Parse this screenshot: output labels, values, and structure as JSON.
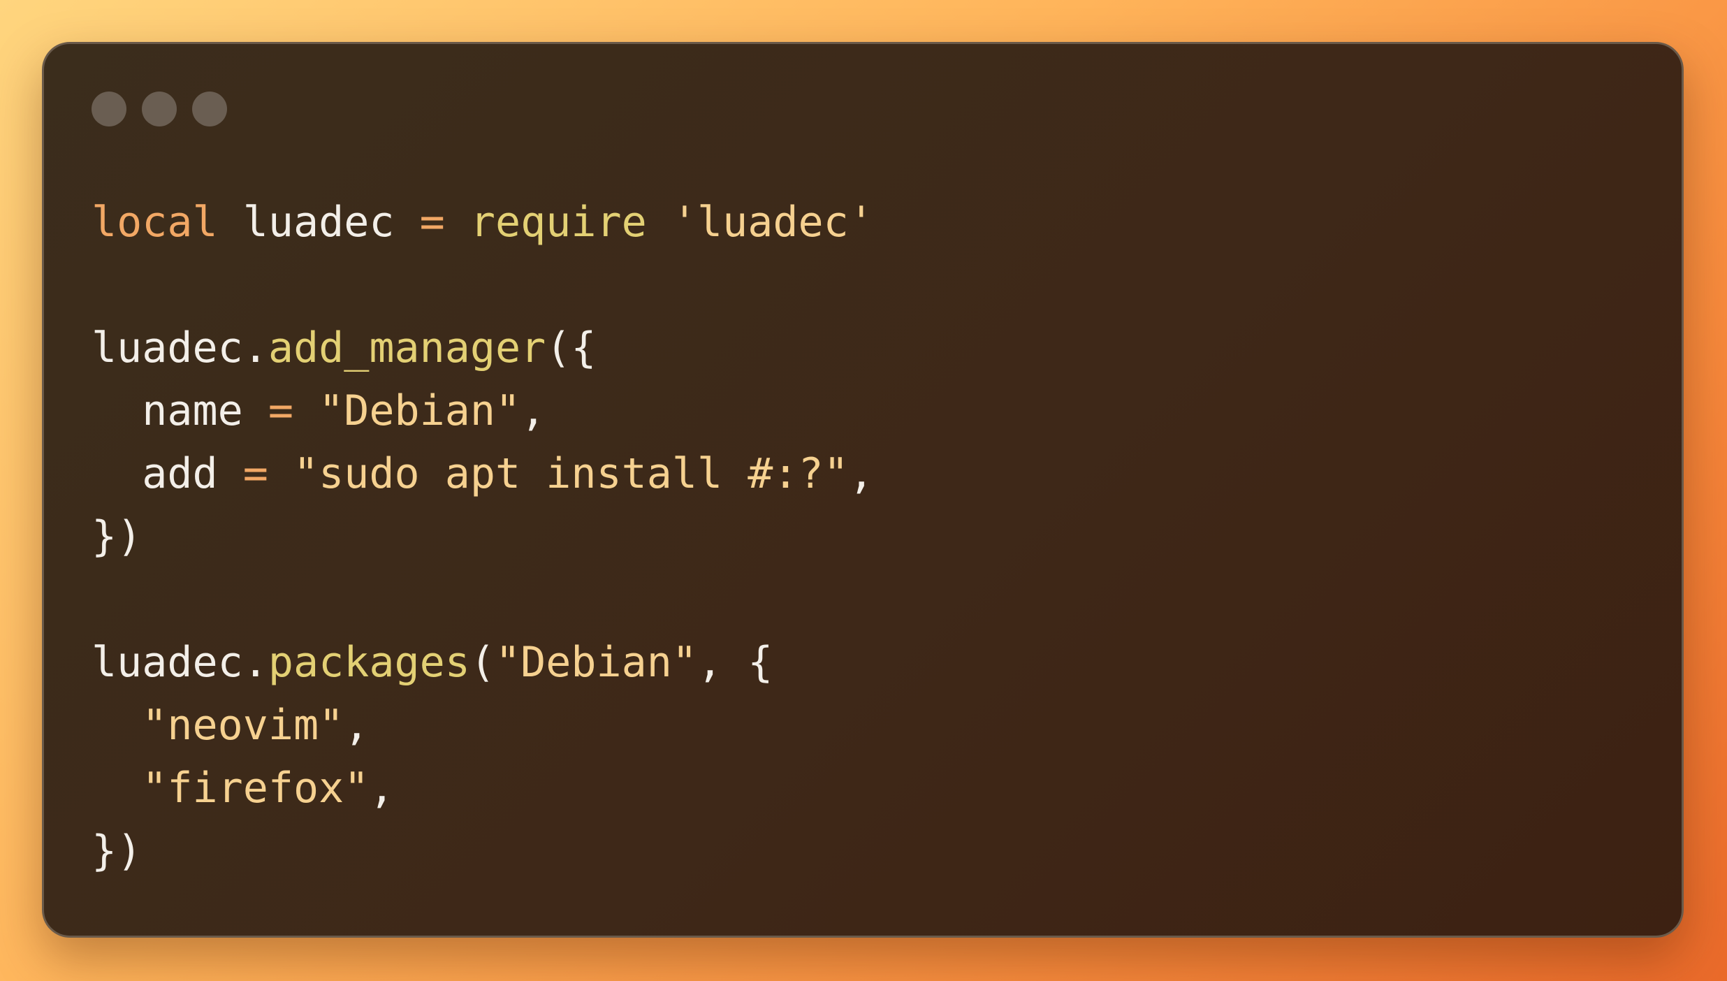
{
  "window": {
    "controls": [
      "window-dot-1",
      "window-dot-2",
      "window-dot-3"
    ]
  },
  "code": {
    "language": "lua",
    "lines": [
      [
        {
          "text": "local",
          "type": "keyword"
        },
        {
          "text": " ",
          "type": "punct"
        },
        {
          "text": "luadec",
          "type": "ident"
        },
        {
          "text": " ",
          "type": "punct"
        },
        {
          "text": "=",
          "type": "op"
        },
        {
          "text": " ",
          "type": "punct"
        },
        {
          "text": "require",
          "type": "func"
        },
        {
          "text": " ",
          "type": "punct"
        },
        {
          "text": "'luadec'",
          "type": "string"
        }
      ],
      [],
      [
        {
          "text": "luadec",
          "type": "ident"
        },
        {
          "text": ".",
          "type": "punct"
        },
        {
          "text": "add_manager",
          "type": "func"
        },
        {
          "text": "({",
          "type": "punct"
        }
      ],
      [
        {
          "text": "  ",
          "type": "punct"
        },
        {
          "text": "name",
          "type": "ident"
        },
        {
          "text": " ",
          "type": "punct"
        },
        {
          "text": "=",
          "type": "op"
        },
        {
          "text": " ",
          "type": "punct"
        },
        {
          "text": "\"Debian\"",
          "type": "string"
        },
        {
          "text": ",",
          "type": "punct"
        }
      ],
      [
        {
          "text": "  ",
          "type": "punct"
        },
        {
          "text": "add",
          "type": "ident"
        },
        {
          "text": " ",
          "type": "punct"
        },
        {
          "text": "=",
          "type": "op"
        },
        {
          "text": " ",
          "type": "punct"
        },
        {
          "text": "\"sudo apt install #:?\"",
          "type": "string"
        },
        {
          "text": ",",
          "type": "punct"
        }
      ],
      [
        {
          "text": "})",
          "type": "punct"
        }
      ],
      [],
      [
        {
          "text": "luadec",
          "type": "ident"
        },
        {
          "text": ".",
          "type": "punct"
        },
        {
          "text": "packages",
          "type": "func"
        },
        {
          "text": "(",
          "type": "punct"
        },
        {
          "text": "\"Debian\"",
          "type": "string"
        },
        {
          "text": ", {",
          "type": "punct"
        }
      ],
      [
        {
          "text": "  ",
          "type": "punct"
        },
        {
          "text": "\"neovim\"",
          "type": "string"
        },
        {
          "text": ",",
          "type": "punct"
        }
      ],
      [
        {
          "text": "  ",
          "type": "punct"
        },
        {
          "text": "\"firefox\"",
          "type": "string"
        },
        {
          "text": ",",
          "type": "punct"
        }
      ],
      [
        {
          "text": "})",
          "type": "punct"
        }
      ]
    ]
  },
  "colors": {
    "keyword": "#f2a865",
    "operator": "#f2a865",
    "function": "#e3d074",
    "string": "#f6d190",
    "identifier": "#f3efe9",
    "window_dot": "#6a5e52"
  }
}
